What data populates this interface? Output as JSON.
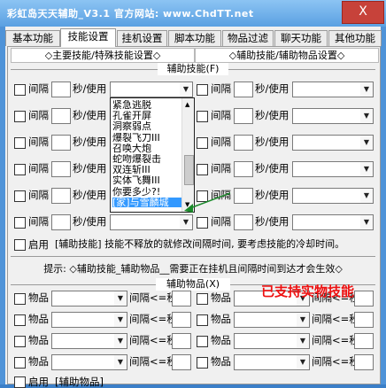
{
  "window": {
    "title": "彩虹岛天天辅助_V3.1    官方网站: www.ChdTT.net",
    "close_label": "X"
  },
  "tabs": [
    "基本功能",
    "技能设置",
    "挂机设置",
    "脚本功能",
    "物品过滤",
    "聊天功能",
    "其他功能"
  ],
  "active_tab": 1,
  "sections": {
    "left": "◇主要技能/特殊技能设置◇",
    "right": "◇辅助技能/辅助物品设置◇"
  },
  "aux_skills": {
    "title": "辅助技能(F)",
    "interval_label": "间隔",
    "sec_use_label": "秒/使用",
    "enable_label": "启用",
    "enable_text": "[辅助技能] 技能不释放的就修改间隔时间, 要考虑技能的冷却时间。"
  },
  "dropdown_options": [
    "紧急逃脱",
    "孔雀开屏",
    "洞察弱点",
    "爆裂飞刀III",
    "召唤大炮",
    "蛇吻爆裂击",
    "双连斩III",
    "实体飞舞III",
    "你要多少?!",
    "[家]与雪麟城"
  ],
  "dropdown_selected": 9,
  "tip": "提示: ◇辅助技能_辅助物品__需要正在挂机且间隔时间到达才会生效◇",
  "aux_items": {
    "title": "辅助物品(X)",
    "item_label": "物品",
    "interval_label": "间隔<=秒",
    "enable_label": "启用",
    "enable_text": "[辅助物品]"
  },
  "overlay_note": "已支持实物技能"
}
